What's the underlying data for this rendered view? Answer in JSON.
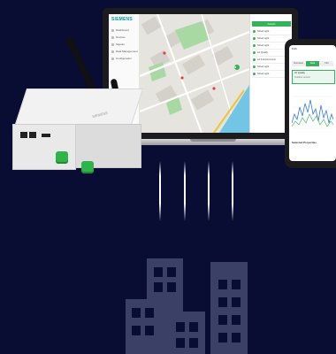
{
  "colors": {
    "background": "#090c33",
    "building": "#3b4166",
    "accent_green": "#34b35a",
    "brand_teal": "#009999"
  },
  "laptop_app": {
    "brand": "SIEMENS",
    "nav_items": [
      "Dashboard",
      "Devices",
      "Signals",
      "Data Management",
      "Configuration"
    ],
    "panel_title": "Assets",
    "panel_rows": [
      "Street Light",
      "Street Light",
      "Street Light",
      "Air Quality",
      "Air & Environment",
      "Street Light",
      "Street Light"
    ]
  },
  "phone_app": {
    "status_time": "9:41",
    "tabs": [
      "Overview",
      "Data",
      "Info"
    ],
    "card_title": "Air Quality",
    "card_subtitle": "Outdoor sensor",
    "footer_label": "Selected Properties"
  },
  "device": {
    "label": "SIEMENS"
  },
  "icons": [
    "antenna-icon",
    "ethernet-port-icon",
    "green-connector-icon",
    "building-icon",
    "map-marker-icon"
  ]
}
